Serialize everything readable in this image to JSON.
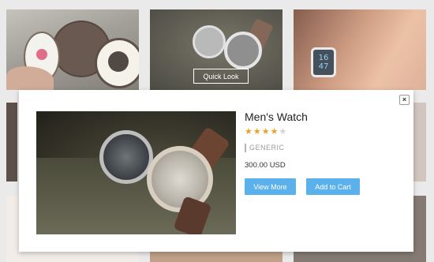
{
  "grid": {
    "quick_look_label": "Quick Look",
    "smartwatch_time": "16\n47"
  },
  "modal": {
    "close_glyph": "×",
    "product_title": "Men's Watch",
    "rating": {
      "value": 4,
      "max": 5,
      "filled_glyph": "★★★★",
      "empty_glyph": "★"
    },
    "brand": "GENERIC",
    "price": "300.00 USD",
    "view_more_label": "View More",
    "add_to_cart_label": "Add to Cart"
  },
  "colors": {
    "accent_button": "#5bb1ec",
    "star": "#e5a52a"
  }
}
